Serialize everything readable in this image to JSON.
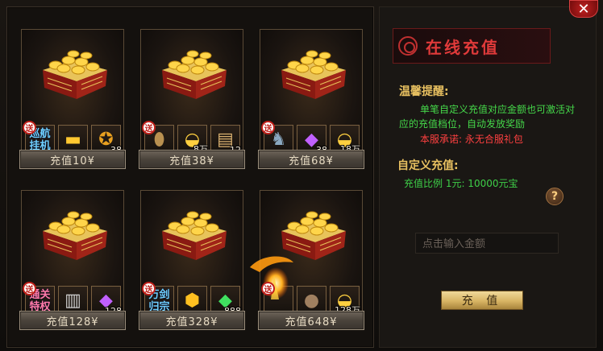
{
  "panel": {
    "title": "在线充值",
    "tip_label": "温馨提醒:",
    "tip_line1": "单笔自定义充值对应金额也可激活对",
    "tip_line2": "应的充值档位，自动发放奖励",
    "promise": "本服承诺: 永无合服礼包",
    "custom_label": "自定义充值:",
    "ratio": "充值比例 1元: 10000元宝",
    "help": "?",
    "amount_placeholder": "点击输入金额",
    "charge_button": "充 值",
    "close": "✕"
  },
  "gift_badge": "送",
  "packages": [
    {
      "button": "充值10¥",
      "items": [
        {
          "icon": "xunhang-guaji-text",
          "text1": "巡航",
          "text2": "挂机",
          "qty": ""
        },
        {
          "icon": "gold-bar-icon",
          "qty": ""
        },
        {
          "icon": "medal-icon",
          "qty": "38"
        }
      ]
    },
    {
      "button": "充值38¥",
      "items": [
        {
          "icon": "hornet-pet-icon",
          "qty": ""
        },
        {
          "icon": "gold-ingot-icon",
          "qty": "8万"
        },
        {
          "icon": "scroll-icon",
          "qty": "12"
        }
      ]
    },
    {
      "button": "充值68¥",
      "items": [
        {
          "icon": "swordsman-icon",
          "qty": ""
        },
        {
          "icon": "purple-gem-icon",
          "qty": "38"
        },
        {
          "icon": "gold-ingot-icon",
          "qty": "18万"
        }
      ]
    },
    {
      "button": "充值128¥",
      "items": [
        {
          "icon": "tongguan-tequan-text",
          "text1": "通关",
          "text2": "特权",
          "qty": ""
        },
        {
          "icon": "paper-icon",
          "qty": ""
        },
        {
          "icon": "purple-gem-icon",
          "qty": "128"
        }
      ]
    },
    {
      "button": "充值328¥",
      "items": [
        {
          "icon": "wanjian-guizong-text",
          "text1": "万剑",
          "text2": "归宗",
          "qty": ""
        },
        {
          "icon": "gold-pile-icon",
          "qty": ""
        },
        {
          "icon": "green-crystal-icon",
          "qty": "888"
        }
      ]
    },
    {
      "button": "充值648¥",
      "items": [
        {
          "icon": "fire-effect-icon",
          "qty": ""
        },
        {
          "icon": "money-bag-icon",
          "qty": ""
        },
        {
          "icon": "gold-ingot-icon",
          "qty": "128万"
        }
      ]
    }
  ]
}
